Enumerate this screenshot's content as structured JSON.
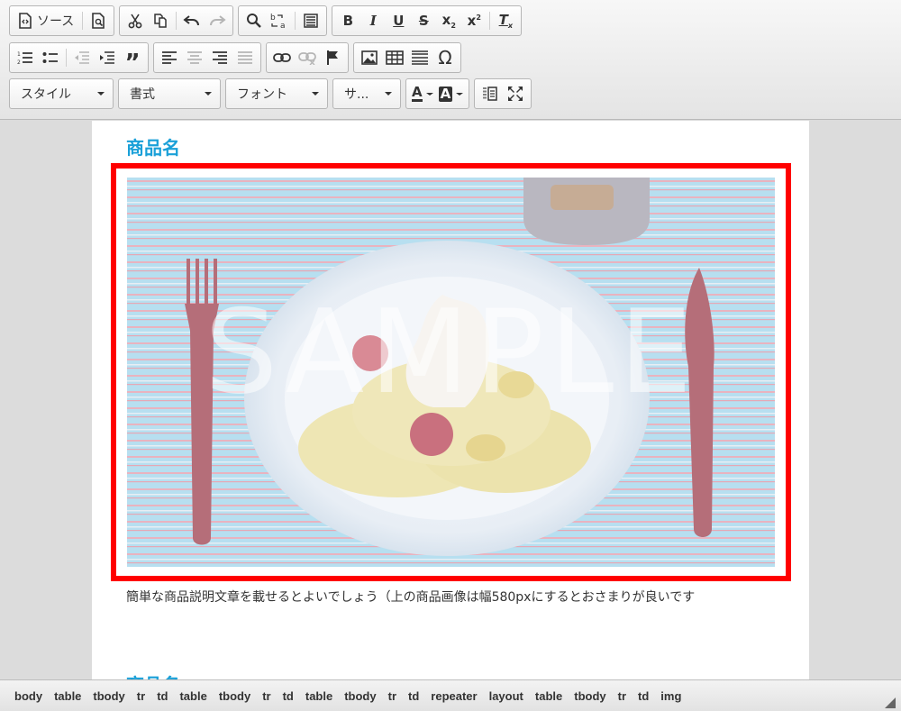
{
  "toolbar": {
    "source_label": "ソース",
    "combos": {
      "style": "スタイル",
      "format": "書式",
      "font": "フォント",
      "size": "サ..."
    }
  },
  "content": {
    "title": "商品名",
    "image_watermark": "SAMPLE",
    "description": "簡単な商品説明文章を載せるとよいでしょう（上の商品画像は幅580pxにするとおさまりが良いです",
    "title_2": "商品名"
  },
  "pathbar": [
    "body",
    "table",
    "tbody",
    "tr",
    "td",
    "table",
    "tbody",
    "tr",
    "td",
    "table",
    "tbody",
    "tr",
    "td",
    "repeater",
    "layout",
    "table",
    "tbody",
    "tr",
    "td",
    "img"
  ],
  "colors": {
    "title": "#1aa0d8",
    "selection_border": "#ff0000"
  }
}
